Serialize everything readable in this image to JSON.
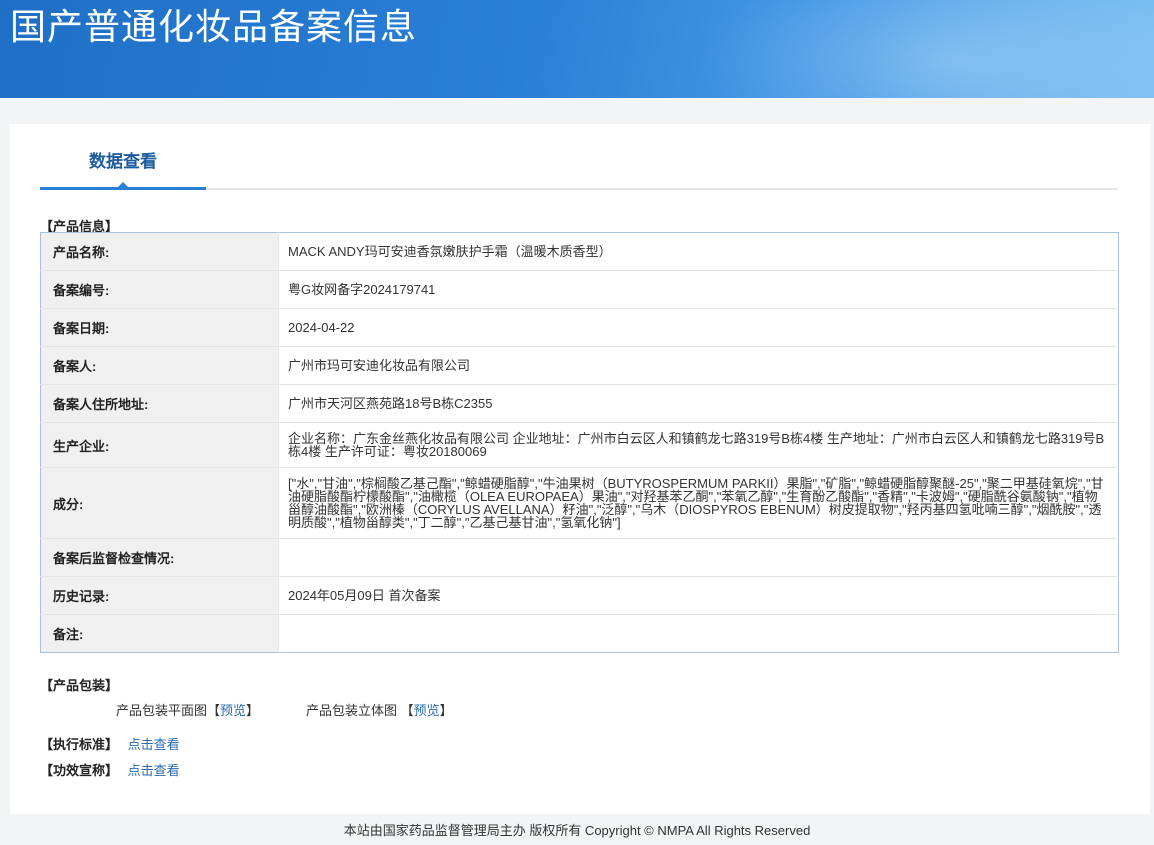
{
  "banner": {
    "title": "国产普通化妆品备案信息"
  },
  "tabs": {
    "active_label": "数据查看"
  },
  "product_info": {
    "section_label": "【产品信息】",
    "rows": [
      {
        "key": "产品名称:",
        "value": "MACK ANDY玛可安迪香氛嫩肤护手霜（温暖木质香型）"
      },
      {
        "key": "备案编号:",
        "value": "粤G妆网备字2024179741"
      },
      {
        "key": "备案日期:",
        "value": "2024-04-22"
      },
      {
        "key": "备案人:",
        "value": "广州市玛可安迪化妆品有限公司"
      },
      {
        "key": "备案人住所地址:",
        "value": "广州市天河区燕苑路18号B栋C2355"
      },
      {
        "key": "生产企业:",
        "value": "企业名称：广东金丝燕化妆品有限公司 企业地址：广州市白云区人和镇鹤龙七路319号B栋4楼 生产地址：广州市白云区人和镇鹤龙七路319号B栋4楼 生产许可证：粤妆20180069"
      },
      {
        "key": "成分:",
        "value": "[\"水\",\"甘油\",\"棕榈酸乙基己酯\",\"鲸蜡硬脂醇\",\"牛油果树（BUTYROSPERMUM PARKII）果脂\",\"矿脂\",\"鲸蜡硬脂醇聚醚-25\",\"聚二甲基硅氧烷\",\"甘油硬脂酸酯柠檬酸酯\",\"油橄榄（OLEA EUROPAEA）果油\",\"对羟基苯乙酮\",\"苯氧乙醇\",\"生育酚乙酸酯\",\"香精\",\"卡波姆\",\"硬脂酰谷氨酸钠\",\"植物甾醇油酸酯\",\"欧洲榛（CORYLUS AVELLANA）籽油\",\"泛醇\",\"乌木（DIOSPYROS EBENUM）树皮提取物\",\"羟丙基四氢吡喃三醇\",\"烟酰胺\",\"透明质酸\",\"植物甾醇类\",\"丁二醇\",\"乙基己基甘油\",\"氢氧化钠\"]"
      },
      {
        "key": "备案后监督检查情况:",
        "value": ""
      },
      {
        "key": "历史记录:",
        "value": "2024年05月09日 首次备案"
      },
      {
        "key": "备注:",
        "value": ""
      }
    ]
  },
  "packaging": {
    "section_label": "【产品包装】",
    "flat_label": "产品包装平面图",
    "solid_label": "产品包装立体图",
    "bracket_open": "【",
    "bracket_close": "】",
    "preview_link": "预览"
  },
  "standard": {
    "label": "【执行标准】",
    "link": "点击查看"
  },
  "claims": {
    "label": "【功效宣称】",
    "link": "点击查看"
  },
  "footer": {
    "text": "本站由国家药品监督管理局主办 版权所有 Copyright © NMPA All Rights Reserved"
  }
}
